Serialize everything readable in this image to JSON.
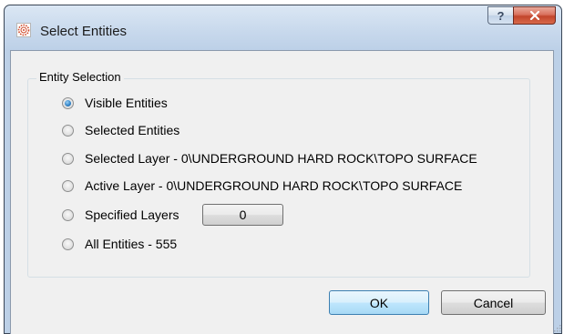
{
  "window": {
    "title": "Select Entities",
    "help_label": "?",
    "close_label": "x"
  },
  "group": {
    "legend": "Entity Selection",
    "options": [
      {
        "label": "Visible Entities",
        "checked": true
      },
      {
        "label": "Selected Entities",
        "checked": false
      },
      {
        "label": "Selected Layer - 0\\UNDERGROUND HARD ROCK\\TOPO SURFACE",
        "checked": false
      },
      {
        "label": "Active Layer - 0\\UNDERGROUND HARD ROCK\\TOPO SURFACE",
        "checked": false
      },
      {
        "label": "Specified Layers",
        "checked": false
      },
      {
        "label": "All Entities - 555",
        "checked": false
      }
    ],
    "specified_layers_value": "0"
  },
  "buttons": {
    "ok": "OK",
    "cancel": "Cancel"
  },
  "colors": {
    "title_bar": "#c7d8ec",
    "close_button": "#c2452c",
    "radio_selected": "#2d7fc4"
  }
}
